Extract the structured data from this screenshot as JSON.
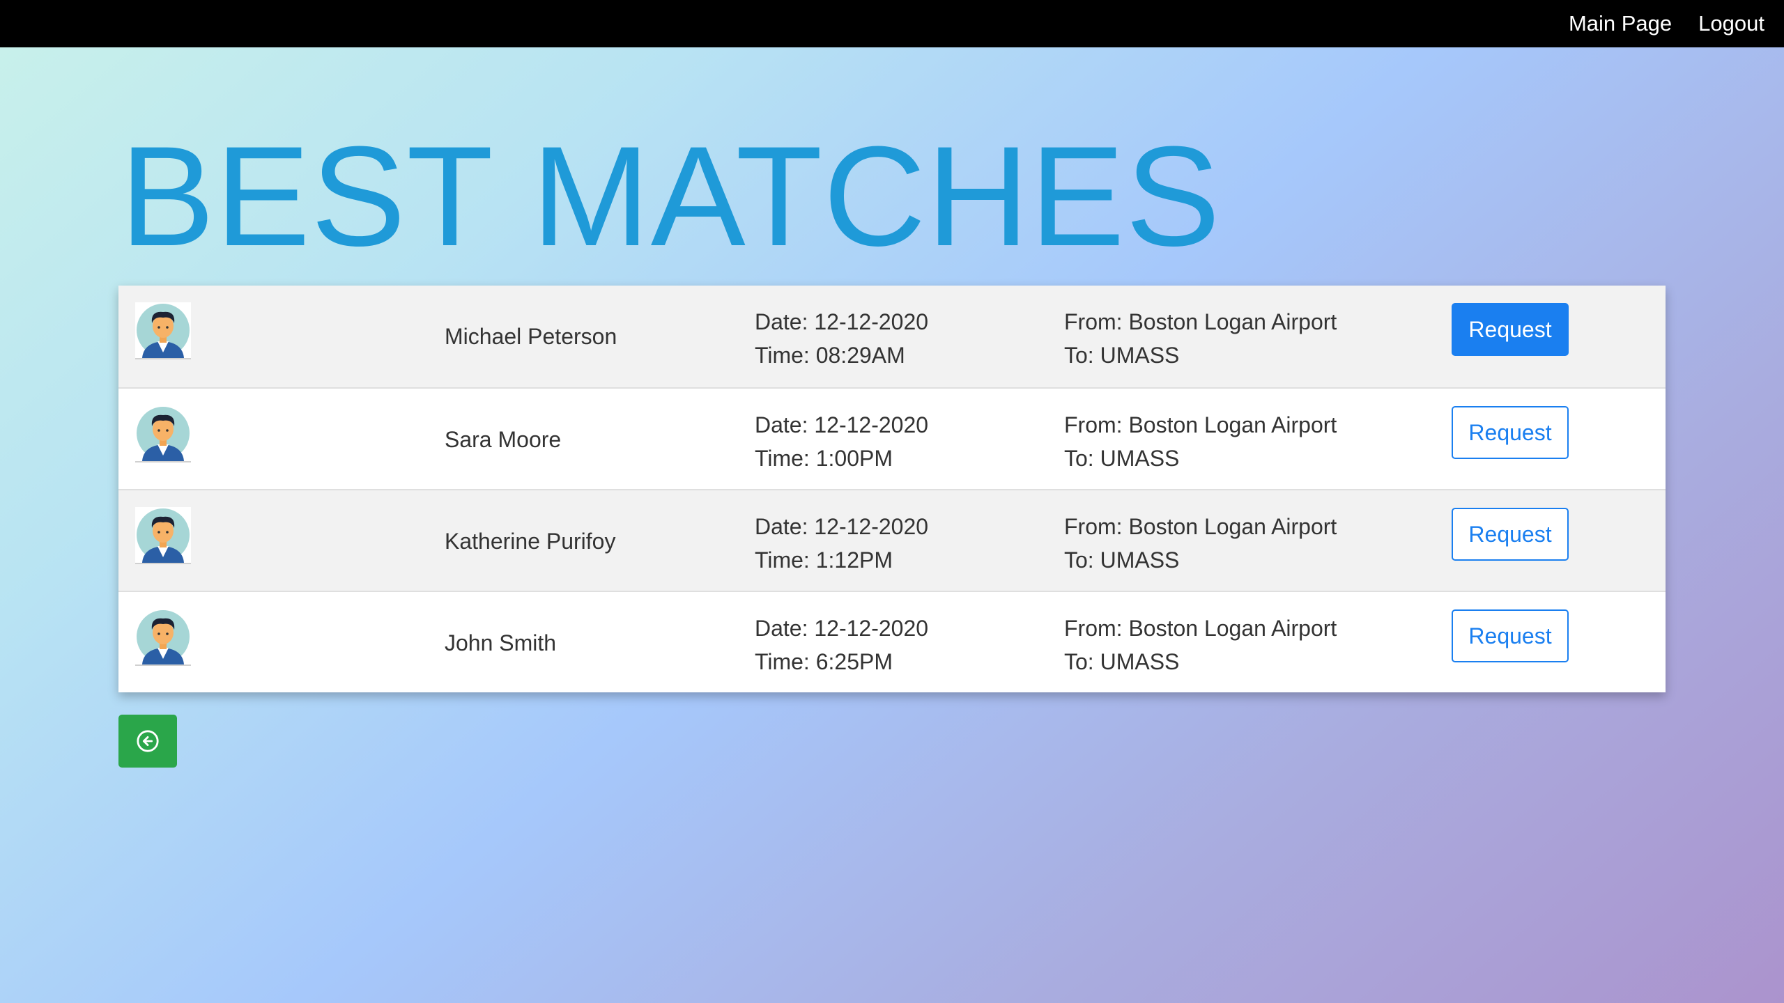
{
  "nav": {
    "main_page": "Main Page",
    "logout": "Logout"
  },
  "title": "BEST MATCHES",
  "matches": [
    {
      "name": "Michael Peterson",
      "date": "Date: 12-12-2020",
      "time": "Time: 08:29AM",
      "from": "From: Boston Logan Airport",
      "to": "To: UMASS",
      "button": "Request",
      "button_style": "primary"
    },
    {
      "name": "Sara Moore",
      "date": "Date: 12-12-2020",
      "time": "Time: 1:00PM",
      "from": "From: Boston Logan Airport",
      "to": "To: UMASS",
      "button": "Request",
      "button_style": "outline"
    },
    {
      "name": "Katherine Purifoy",
      "date": "Date: 12-12-2020",
      "time": "Time: 1:12PM",
      "from": "From: Boston Logan Airport",
      "to": "To: UMASS",
      "button": "Request",
      "button_style": "outline"
    },
    {
      "name": "John Smith",
      "date": "Date: 12-12-2020",
      "time": "Time: 6:25PM",
      "from": "From: Boston Logan Airport",
      "to": "To: UMASS",
      "button": "Request",
      "button_style": "outline"
    }
  ],
  "icons": {
    "avatar": "user-avatar-icon",
    "back": "arrow-left-circle-icon"
  },
  "colors": {
    "accent": "#1a7ff0",
    "title": "#1f9ad8",
    "back_button": "#2aa64a",
    "navbar": "#000000"
  }
}
